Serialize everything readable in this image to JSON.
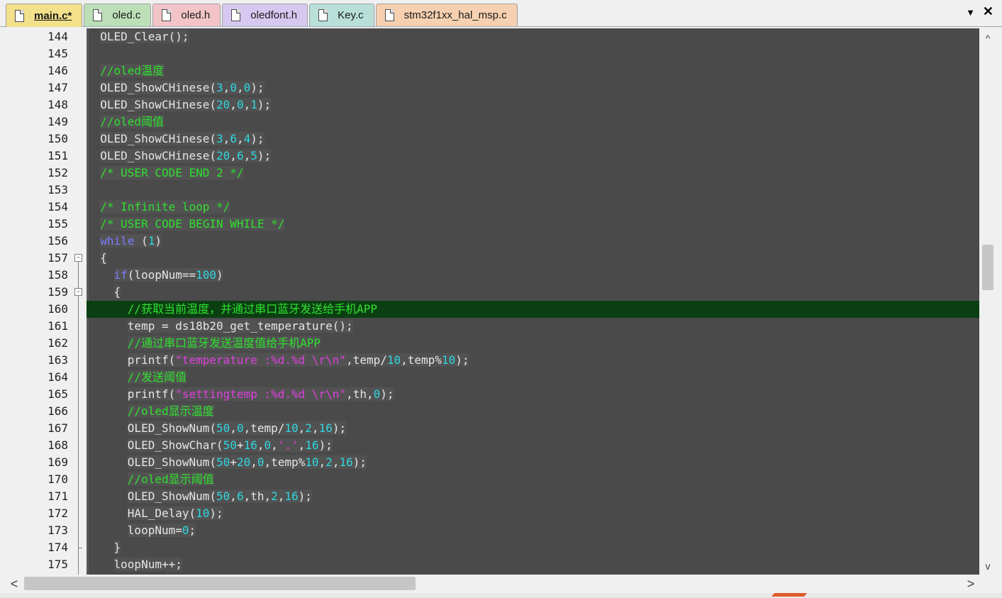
{
  "tabs": [
    {
      "label": "main.c*",
      "active": true,
      "color": "#f2e08a"
    },
    {
      "label": "oled.c",
      "active": false,
      "color": "#bcdfb8"
    },
    {
      "label": "oled.h",
      "active": false,
      "color": "#f2c4c8"
    },
    {
      "label": "oledfont.h",
      "active": false,
      "color": "#d6c8f0"
    },
    {
      "label": "Key.c",
      "active": false,
      "color": "#b8e0d8"
    },
    {
      "label": "stm32f1xx_hal_msp.c",
      "active": false,
      "color": "#f6d0b0"
    }
  ],
  "tab_controls": {
    "dropdown_icon": "▼",
    "close_icon": "✕"
  },
  "scroll_icons": {
    "up": "^",
    "down": "v",
    "left": "<",
    "right": ">"
  },
  "colors": {
    "editor_bg": "#4a4a4a",
    "current_line": "#0b3f12",
    "comment": "#2fe02f",
    "keyword": "#7b7bff",
    "number": "#2fd7e0",
    "string": "#e040e0",
    "text": "#e6e6e6"
  },
  "fold_markers": [
    {
      "line": "157",
      "symbol": "-"
    },
    {
      "line": "159",
      "symbol": "-"
    }
  ],
  "current_line": "160",
  "lines": [
    {
      "n": "144",
      "indent": "",
      "tokens": [
        [
          "t",
          "OLED_Clear();"
        ]
      ]
    },
    {
      "n": "145",
      "indent": "",
      "tokens": []
    },
    {
      "n": "146",
      "indent": "",
      "tokens": [
        [
          "c",
          "//oled温度"
        ]
      ]
    },
    {
      "n": "147",
      "indent": "",
      "tokens": [
        [
          "t",
          "OLED_ShowCHinese("
        ],
        [
          "n",
          "3"
        ],
        [
          "t",
          ","
        ],
        [
          "n",
          "0"
        ],
        [
          "t",
          ","
        ],
        [
          "n",
          "0"
        ],
        [
          "t",
          ");"
        ]
      ]
    },
    {
      "n": "148",
      "indent": "",
      "tokens": [
        [
          "t",
          "OLED_ShowCHinese("
        ],
        [
          "n",
          "20"
        ],
        [
          "t",
          ","
        ],
        [
          "n",
          "0"
        ],
        [
          "t",
          ","
        ],
        [
          "n",
          "1"
        ],
        [
          "t",
          ");"
        ]
      ]
    },
    {
      "n": "149",
      "indent": "",
      "tokens": [
        [
          "c",
          "//oled阈值"
        ]
      ]
    },
    {
      "n": "150",
      "indent": "",
      "tokens": [
        [
          "t",
          "OLED_ShowCHinese("
        ],
        [
          "n",
          "3"
        ],
        [
          "t",
          ","
        ],
        [
          "n",
          "6"
        ],
        [
          "t",
          ","
        ],
        [
          "n",
          "4"
        ],
        [
          "t",
          ");"
        ]
      ]
    },
    {
      "n": "151",
      "indent": "",
      "tokens": [
        [
          "t",
          "OLED_ShowCHinese("
        ],
        [
          "n",
          "20"
        ],
        [
          "t",
          ","
        ],
        [
          "n",
          "6"
        ],
        [
          "t",
          ","
        ],
        [
          "n",
          "5"
        ],
        [
          "t",
          ");"
        ]
      ]
    },
    {
      "n": "152",
      "indent": "",
      "tokens": [
        [
          "c",
          "/* USER CODE END 2 */"
        ]
      ]
    },
    {
      "n": "153",
      "indent": "",
      "tokens": []
    },
    {
      "n": "154",
      "indent": "",
      "tokens": [
        [
          "c",
          "/* Infinite loop */"
        ]
      ]
    },
    {
      "n": "155",
      "indent": "",
      "tokens": [
        [
          "c",
          "/* USER CODE BEGIN WHILE */"
        ]
      ]
    },
    {
      "n": "156",
      "indent": "",
      "tokens": [
        [
          "k",
          "while"
        ],
        [
          "t",
          " ("
        ],
        [
          "n",
          "1"
        ],
        [
          "t",
          ")"
        ]
      ]
    },
    {
      "n": "157",
      "indent": "",
      "tokens": [
        [
          "t",
          "{"
        ]
      ]
    },
    {
      "n": "158",
      "indent": "  ",
      "tokens": [
        [
          "k",
          "if"
        ],
        [
          "t",
          "(loopNum=="
        ],
        [
          "n",
          "100"
        ],
        [
          "t",
          ")"
        ]
      ]
    },
    {
      "n": "159",
      "indent": "  ",
      "tokens": [
        [
          "t",
          "{"
        ]
      ]
    },
    {
      "n": "160",
      "indent": "    ",
      "tokens": [
        [
          "c",
          "//获取当前温度，并通过串口蓝牙发送给手机APP"
        ]
      ]
    },
    {
      "n": "161",
      "indent": "    ",
      "tokens": [
        [
          "t",
          "temp = ds18b20_get_temperature();"
        ]
      ]
    },
    {
      "n": "162",
      "indent": "    ",
      "tokens": [
        [
          "c",
          "//通过串口蓝牙发送温度值给手机APP"
        ]
      ]
    },
    {
      "n": "163",
      "indent": "    ",
      "tokens": [
        [
          "t",
          "printf("
        ],
        [
          "s",
          "\"temperature :%d.%d \\r\\n\""
        ],
        [
          "t",
          ",temp/"
        ],
        [
          "n",
          "10"
        ],
        [
          "t",
          ",temp%"
        ],
        [
          "n",
          "10"
        ],
        [
          "t",
          ");"
        ]
      ]
    },
    {
      "n": "164",
      "indent": "    ",
      "tokens": [
        [
          "c",
          "//发送阈值"
        ]
      ]
    },
    {
      "n": "165",
      "indent": "    ",
      "tokens": [
        [
          "t",
          "printf("
        ],
        [
          "s",
          "\"settingtemp :%d.%d \\r\\n\""
        ],
        [
          "t",
          ",th,"
        ],
        [
          "n",
          "0"
        ],
        [
          "t",
          ");"
        ]
      ]
    },
    {
      "n": "166",
      "indent": "    ",
      "tokens": [
        [
          "c",
          "//oled显示温度"
        ]
      ]
    },
    {
      "n": "167",
      "indent": "    ",
      "tokens": [
        [
          "t",
          "OLED_ShowNum("
        ],
        [
          "n",
          "50"
        ],
        [
          "t",
          ","
        ],
        [
          "n",
          "0"
        ],
        [
          "t",
          ",temp/"
        ],
        [
          "n",
          "10"
        ],
        [
          "t",
          ","
        ],
        [
          "n",
          "2"
        ],
        [
          "t",
          ","
        ],
        [
          "n",
          "16"
        ],
        [
          "t",
          ");"
        ]
      ]
    },
    {
      "n": "168",
      "indent": "    ",
      "tokens": [
        [
          "t",
          "OLED_ShowChar("
        ],
        [
          "n",
          "50"
        ],
        [
          "t",
          "+"
        ],
        [
          "n",
          "16"
        ],
        [
          "t",
          ","
        ],
        [
          "n",
          "0"
        ],
        [
          "t",
          ","
        ],
        [
          "s",
          "'.'"
        ],
        [
          "t",
          ","
        ],
        [
          "n",
          "16"
        ],
        [
          "t",
          ");"
        ]
      ]
    },
    {
      "n": "169",
      "indent": "    ",
      "tokens": [
        [
          "t",
          "OLED_ShowNum("
        ],
        [
          "n",
          "50"
        ],
        [
          "t",
          "+"
        ],
        [
          "n",
          "20"
        ],
        [
          "t",
          ","
        ],
        [
          "n",
          "0"
        ],
        [
          "t",
          ",temp%"
        ],
        [
          "n",
          "10"
        ],
        [
          "t",
          ","
        ],
        [
          "n",
          "2"
        ],
        [
          "t",
          ","
        ],
        [
          "n",
          "16"
        ],
        [
          "t",
          ");"
        ]
      ]
    },
    {
      "n": "170",
      "indent": "    ",
      "tokens": [
        [
          "c",
          "//oled显示阈值"
        ]
      ]
    },
    {
      "n": "171",
      "indent": "    ",
      "tokens": [
        [
          "t",
          "OLED_ShowNum("
        ],
        [
          "n",
          "50"
        ],
        [
          "t",
          ","
        ],
        [
          "n",
          "6"
        ],
        [
          "t",
          ",th,"
        ],
        [
          "n",
          "2"
        ],
        [
          "t",
          ","
        ],
        [
          "n",
          "16"
        ],
        [
          "t",
          ");"
        ]
      ]
    },
    {
      "n": "172",
      "indent": "    ",
      "tokens": [
        [
          "t",
          "HAL_Delay("
        ],
        [
          "n",
          "10"
        ],
        [
          "t",
          ");"
        ]
      ]
    },
    {
      "n": "173",
      "indent": "    ",
      "tokens": [
        [
          "t",
          "loopNum="
        ],
        [
          "n",
          "0"
        ],
        [
          "t",
          ";"
        ]
      ]
    },
    {
      "n": "174",
      "indent": "  ",
      "tokens": [
        [
          "t",
          "}"
        ]
      ]
    },
    {
      "n": "175",
      "indent": "  ",
      "tokens": [
        [
          "t",
          "loopNum++;"
        ]
      ]
    }
  ]
}
